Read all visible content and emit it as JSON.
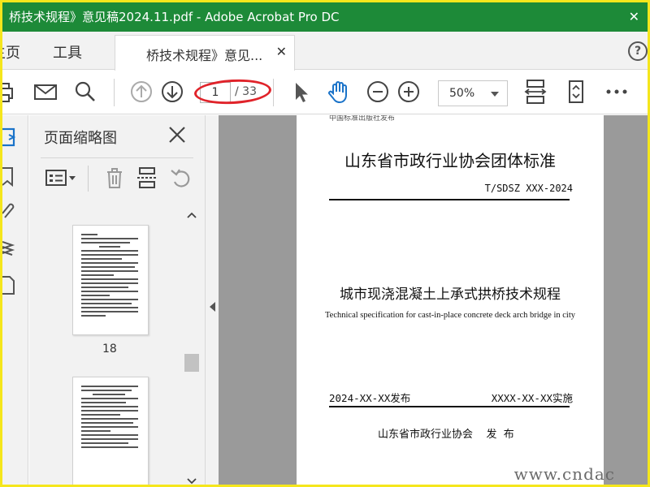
{
  "window": {
    "title": "桥技术规程》意见稿2024.11.pdf - Adobe Acrobat Pro DC",
    "close_glyph": "✕"
  },
  "menu": {
    "home_label": "主页",
    "tools_label": "工具",
    "help_glyph": "?"
  },
  "tab": {
    "label": "桥技术规程》意见...",
    "close_glyph": "✕"
  },
  "toolbar": {
    "current_page": "1",
    "total_pages": "/ 33",
    "zoom": "50%"
  },
  "thumbnail_panel": {
    "title": "页面缩略图",
    "thumbnails": [
      {
        "page_label": "18"
      },
      {
        "page_label": ""
      }
    ]
  },
  "document": {
    "header_small": "中国标准出版社发布",
    "title": "山东省市政行业协会团体标准",
    "standard_no": "T/SDSZ  XXX-2024",
    "cn_title": "城市现浇混凝土上承式拱桥技术规程",
    "en_title": "Technical specification for cast-in-place concrete deck arch bridge in city",
    "publish_date": "2024-XX-XX发布",
    "effective_date": "XXXX-XX-XX实施",
    "issuer": "山东省市政行业协会    发  布"
  },
  "watermark": "www.cndac",
  "colors": {
    "titlebar": "#1d8a38",
    "frame": "#f5e61c",
    "highlight": "#e0232a",
    "hand_tool": "#1a73c9"
  }
}
